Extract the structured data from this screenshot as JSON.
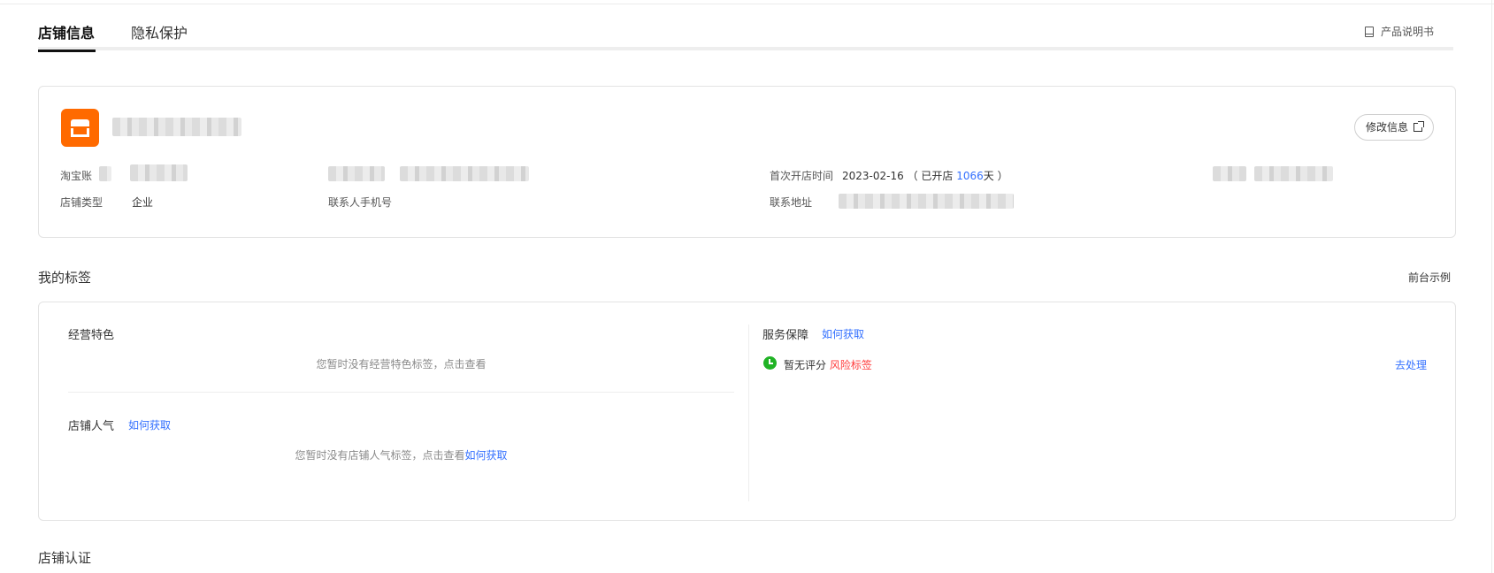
{
  "tabs": [
    {
      "label": "店铺信息",
      "active": true
    },
    {
      "label": "隐私保护",
      "active": false
    }
  ],
  "manual_label": "产品说明书",
  "info": {
    "edit_button": "修改信息",
    "taobao_account_label": "淘宝账",
    "first_open_label": "首次开店时间",
    "first_open_date": "2023-02-16",
    "opened_prefix": "（ 已开店",
    "opened_days": "1066",
    "opened_suffix": "天 ）",
    "shop_type_label": "店铺类型",
    "shop_type_value": "企业",
    "contact_phone_label": "联系人手机号",
    "address_label": "联系地址"
  },
  "tags_section": {
    "title": "我的标签",
    "front_example": "前台示例",
    "business_features": {
      "title": "经营特色",
      "empty": "您暂时没有经营特色标签，点击查看"
    },
    "popularity": {
      "title": "店铺人气",
      "how_to_get": "如何获取",
      "empty_prefix": "您暂时没有店铺人气标签，点击查看",
      "empty_link": "如何获取"
    },
    "service": {
      "title": "服务保障",
      "how_to_get": "如何获取",
      "status": "暂无评分",
      "risk": "风险标签",
      "action": "去处理"
    }
  },
  "certification_title": "店铺认证",
  "colors": {
    "brand": "#ff6a00",
    "link": "#3370ff",
    "ok": "#20b325",
    "risk": "#ff3b3b"
  }
}
